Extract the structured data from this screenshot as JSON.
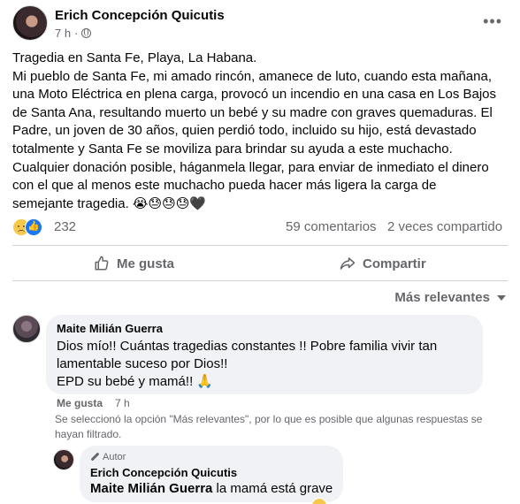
{
  "post": {
    "author": "Erich Concepción Quicutis",
    "time": "7 h",
    "separator": "·",
    "more_label": "•••",
    "body_lines": [
      "Tragedia en Santa Fe, Playa, La Habana.",
      "Mi pueblo de Santa Fe, mi amado rincón, amanece de luto, cuando esta mañana,",
      "una Moto Eléctrica en plena carga, provocó un incendio en una casa en Los Bajos",
      "de Santa Ana, resultando muerto un bebé y su madre con graves quemaduras. El",
      "Padre, un joven de 30 años, quien perdió todo, incluido su hijo, está devastado",
      "totalmente y Santa Fe se moviliza para brindar su ayuda a este muchacho.",
      "Cualquier donación posible, háganmela llegar, para enviar de inmediato el dinero",
      "con el que al menos este muchacho pueda hacer más ligera la carga de",
      "semejante tragedia. 😭😓😓😓🖤"
    ]
  },
  "stats": {
    "reaction_count": "232",
    "comments": "59 comentarios",
    "shares": "2 veces compartido",
    "reaction_icons": [
      "sad-icon",
      "like-icon"
    ]
  },
  "actions": {
    "like": "Me gusta",
    "share": "Compartir"
  },
  "sort": {
    "label": "Más relevantes"
  },
  "comments": [
    {
      "name": "Maite Milián Guerra",
      "lines": [
        "Dios mío!! Cuántas tragedias constantes !! Pobre familia vivir tan",
        "lamentable suceso por Dios!!",
        "EPD su bebé y mamá!! 🙏"
      ],
      "like": "Me gusta",
      "time": "7 h"
    }
  ],
  "filter_note": [
    "Se seleccionó la opción \"Más relevantes\", por lo que es posible que algunas respuestas se",
    "hayan filtrado."
  ],
  "reply": {
    "badge": "Autor",
    "name": "Erich Concepción Quicutis",
    "mention": "Maite Milián Guerra",
    "text": " la mamá está grave"
  },
  "colors": {
    "secondary_text": "#65676b",
    "bubble": "#f0f2f5",
    "like_blue": "#1877f2",
    "divider": "#ced0d4"
  }
}
